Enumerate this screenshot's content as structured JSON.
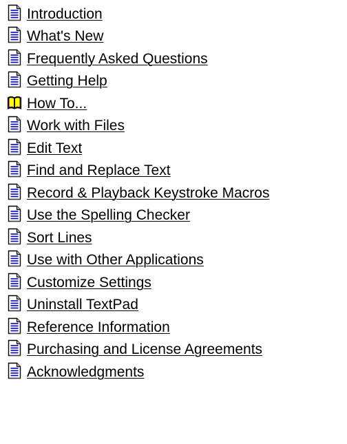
{
  "toc": {
    "items": [
      {
        "label": "Introduction",
        "icon": "document-icon"
      },
      {
        "label": "What's New",
        "icon": "document-icon"
      },
      {
        "label": "Frequently Asked Questions",
        "icon": "document-icon"
      },
      {
        "label": "Getting Help",
        "icon": "document-icon"
      },
      {
        "label": "How To...",
        "icon": "open-book-icon"
      },
      {
        "label": "Work with Files",
        "icon": "document-icon"
      },
      {
        "label": "Edit Text",
        "icon": "document-icon"
      },
      {
        "label": "Find and Replace Text",
        "icon": "document-icon"
      },
      {
        "label": "Record & Playback Keystroke Macros",
        "icon": "document-icon"
      },
      {
        "label": "Use the Spelling Checker",
        "icon": "document-icon"
      },
      {
        "label": "Sort Lines",
        "icon": "document-icon"
      },
      {
        "label": "Use with Other Applications",
        "icon": "document-icon"
      },
      {
        "label": "Customize Settings",
        "icon": "document-icon"
      },
      {
        "label": "Uninstall TextPad",
        "icon": "document-icon"
      },
      {
        "label": "Reference Information",
        "icon": "document-icon"
      },
      {
        "label": "Purchasing and License Agreements",
        "icon": "document-icon"
      },
      {
        "label": "Acknowledgments",
        "icon": "document-icon"
      }
    ]
  },
  "colors": {
    "link_text": "#000000",
    "background": "#ffffff",
    "document_icon_fill": "#ffffff",
    "document_icon_lines": "#0000c0",
    "book_cover": "#800080",
    "book_pages": "#ffff00"
  }
}
